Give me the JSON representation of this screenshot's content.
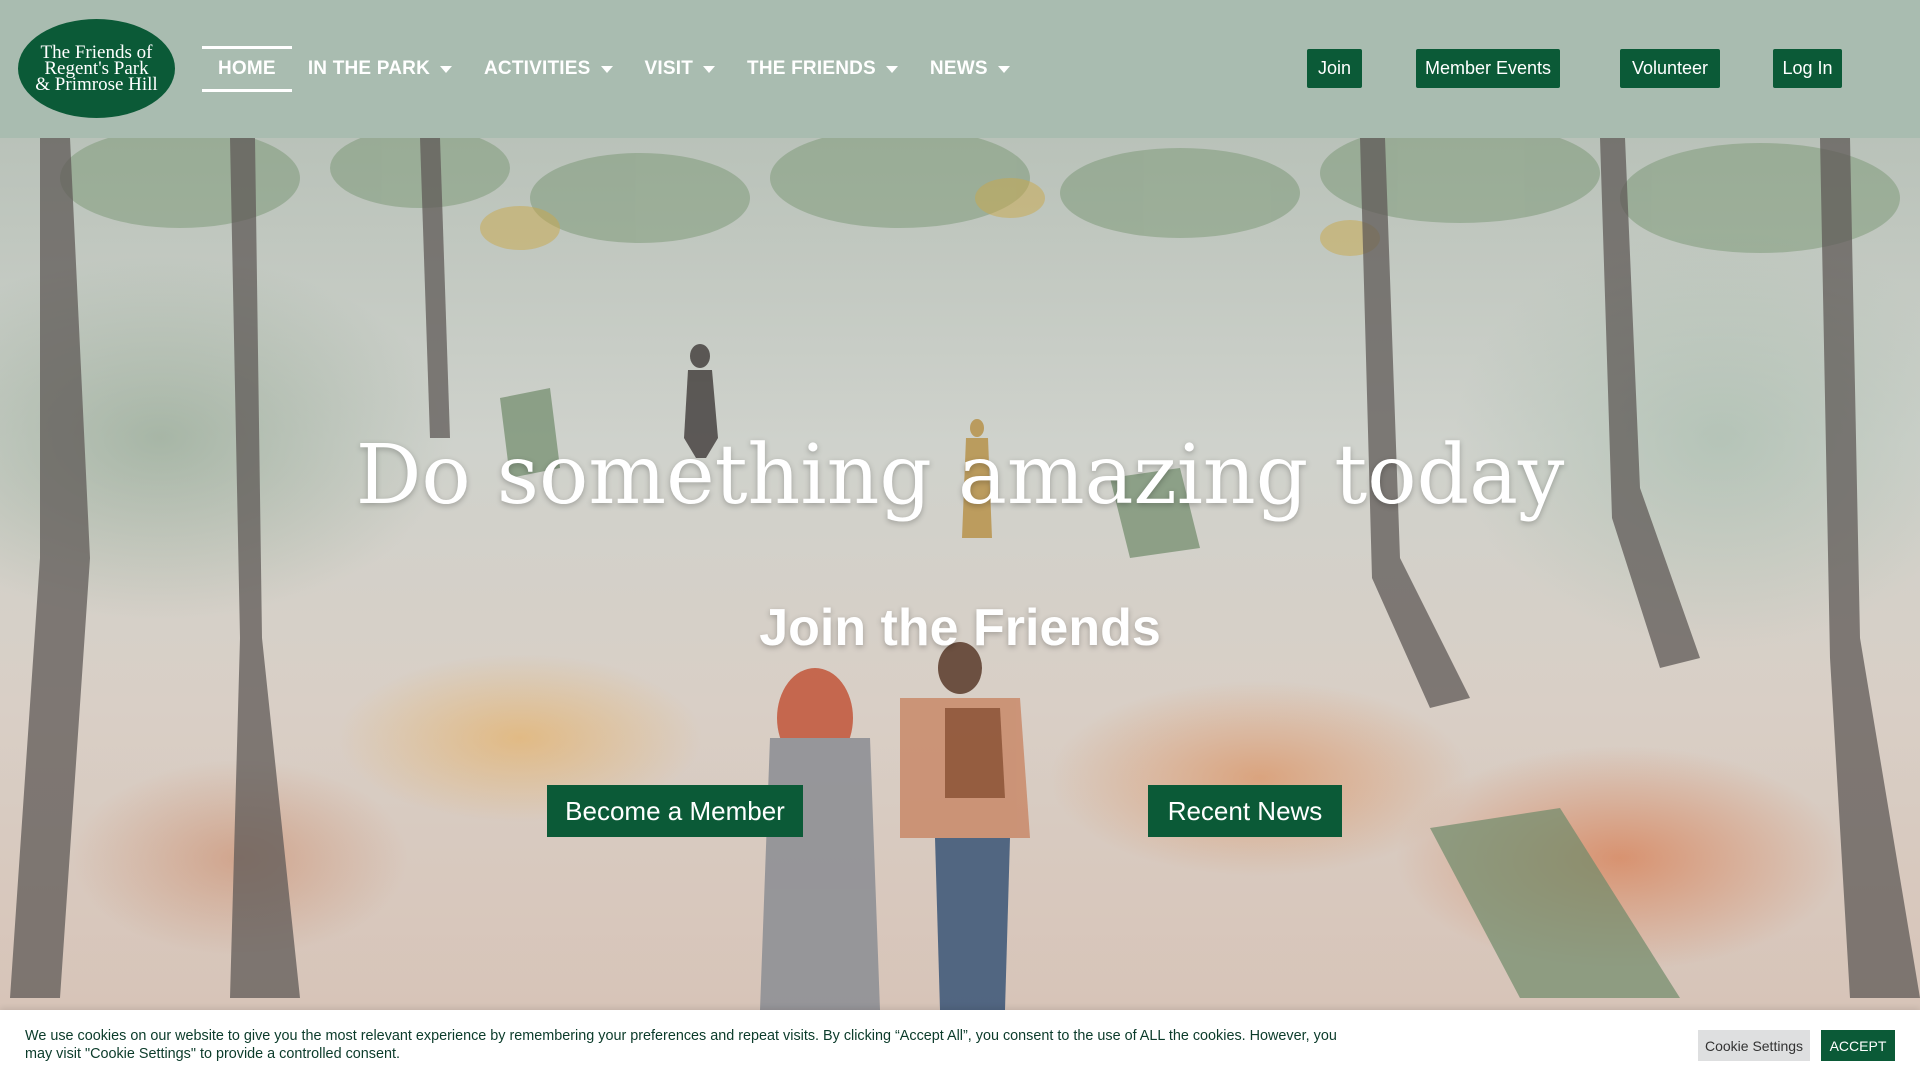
{
  "logo": {
    "lines": [
      "The Friends of",
      "Regent's Park",
      "& Primrose Hill"
    ]
  },
  "nav": {
    "items": [
      {
        "label": "HOME",
        "active": true,
        "has_dropdown": false
      },
      {
        "label": "IN THE PARK",
        "active": false,
        "has_dropdown": true
      },
      {
        "label": "ACTIVITIES",
        "active": false,
        "has_dropdown": true
      },
      {
        "label": "VISIT",
        "active": false,
        "has_dropdown": true
      },
      {
        "label": "THE FRIENDS",
        "active": false,
        "has_dropdown": true
      },
      {
        "label": "NEWS",
        "active": false,
        "has_dropdown": true
      }
    ]
  },
  "header_buttons": {
    "join": "Join",
    "member_events": "Member Events",
    "volunteer": "Volunteer",
    "log_in": "Log In"
  },
  "hero": {
    "title": "Do something amazing today",
    "subtitle": "Join the Friends",
    "cta_member": "Become a Member",
    "cta_news": "Recent News"
  },
  "cookie": {
    "text": "We use cookies on our website to give you the most relevant experience by remembering your preferences and repeat visits. By clicking “Accept All”, you consent to the use of ALL the cookies. However, you may visit \"Cookie Settings\" to provide a controlled consent.",
    "settings_label": "Cookie Settings",
    "accept_label": "ACCEPT"
  },
  "colors": {
    "header_bg": "#a9bcb0",
    "brand_green": "#0b5a37",
    "cookie_text": "#0b3b2a"
  }
}
